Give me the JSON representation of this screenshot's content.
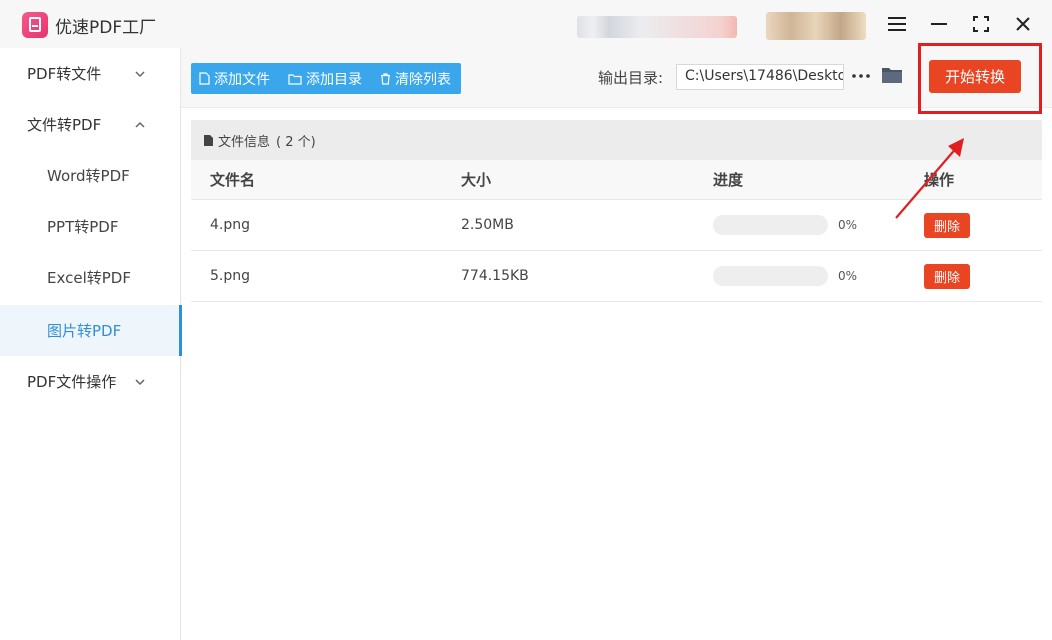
{
  "app": {
    "title": "优速PDF工厂"
  },
  "sidebar": {
    "items": [
      {
        "label": "PDF转文件"
      },
      {
        "label": "文件转PDF"
      },
      {
        "label": "Word转PDF"
      },
      {
        "label": "PPT转PDF"
      },
      {
        "label": "Excel转PDF"
      },
      {
        "label": "图片转PDF"
      },
      {
        "label": "PDF文件操作"
      }
    ]
  },
  "toolbar": {
    "add_file": "添加文件",
    "add_folder": "添加目录",
    "clear_list": "清除列表",
    "output_label": "输出目录:",
    "output_path": "C:\\Users\\17486\\Deskto",
    "start_label": "开始转换"
  },
  "panel": {
    "info_label": "文件信息",
    "info_count": "( 2 个)",
    "columns": [
      "文件名",
      "大小",
      "进度",
      "操作"
    ],
    "rows": [
      {
        "name": "4.png",
        "size": "2.50MB",
        "progress": 0,
        "progress_label": "0%",
        "action": "删除"
      },
      {
        "name": "5.png",
        "size": "774.15KB",
        "progress": 0,
        "progress_label": "0%",
        "action": "删除"
      }
    ]
  },
  "colors": {
    "accent_blue": "#3aa7ec",
    "action_red": "#e94523",
    "annotation_red": "#e02020"
  }
}
